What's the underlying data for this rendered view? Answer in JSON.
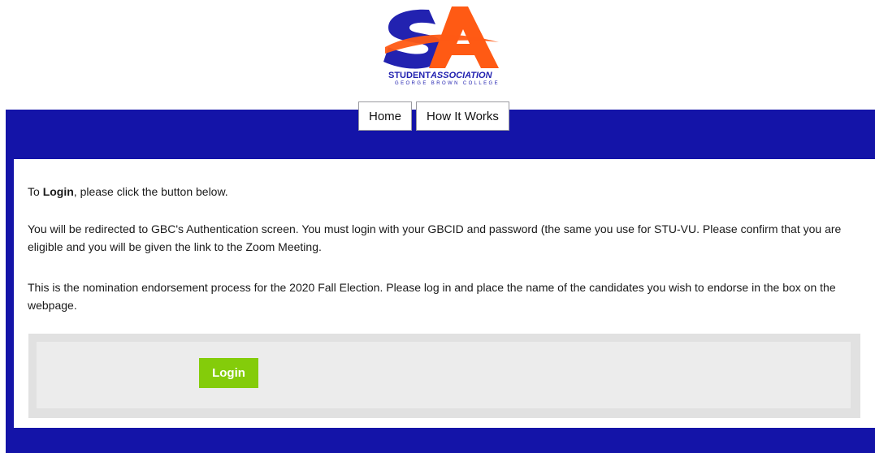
{
  "header": {
    "logo_letters": "SA",
    "logo_line1_a": "STUDENT",
    "logo_line1_b": "ASSOCIATION",
    "logo_line2": "GEORGE BROWN COLLEGE"
  },
  "nav": {
    "items": [
      {
        "label": "Home"
      },
      {
        "label": "How It Works"
      }
    ]
  },
  "main": {
    "p1_prefix": "To ",
    "p1_bold": "Login",
    "p1_suffix": ", please click the button below.",
    "p2": "You will be redirected to GBC's Authentication screen. You must login with your GBCID and password (the same you use for STU-VU. Please confirm that you are eligible and you will be given the link to the Zoom Meeting.",
    "p3": "This is the nomination endorsement process for the 2020 Fall Election.  Please log in and place the name of the candidates you wish to endorse in the box on the webpage.",
    "login_label": "Login"
  },
  "colors": {
    "band": "#1414a8",
    "logo_orange": "#ff5a14",
    "logo_blue": "#2222b0",
    "login_green": "#84cc0a"
  }
}
